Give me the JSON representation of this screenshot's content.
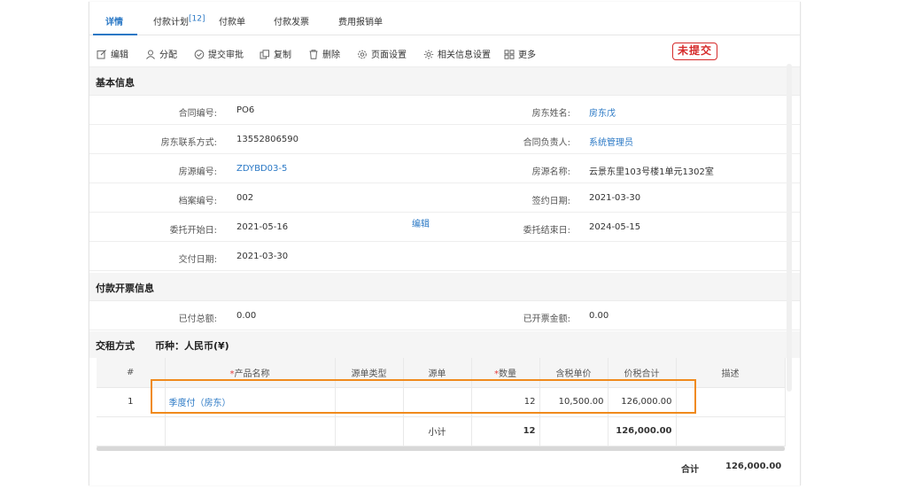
{
  "tabs": [
    {
      "label": "详情"
    },
    {
      "label": "付款计划",
      "badge": "[12]"
    },
    {
      "label": "付款单"
    },
    {
      "label": "付款发票"
    },
    {
      "label": "费用报销单"
    }
  ],
  "toolbar": {
    "edit": "编辑",
    "assign": "分配",
    "submit": "提交审批",
    "copy": "复制",
    "delete": "删除",
    "page_settings": "页面设置",
    "related_settings": "相关信息设置",
    "more": "更多"
  },
  "status_stamp": "未提交",
  "basic": {
    "title": "基本信息",
    "contract_no_label": "合同编号:",
    "contract_no": "PO6",
    "landlord_name_label": "房东姓名:",
    "landlord_name": "房东戊",
    "landlord_contact_label": "房东联系方式:",
    "landlord_contact": "13552806590",
    "contract_owner_label": "合同负责人:",
    "contract_owner": "系统管理员",
    "house_no_label": "房源编号:",
    "house_no": "ZDYBD03-5",
    "house_name_label": "房源名称:",
    "house_name": "云景东里103号楼1单元1302室",
    "archive_no_label": "档案编号:",
    "archive_no": "002",
    "sign_date_label": "签约日期:",
    "sign_date": "2021-03-30",
    "entrust_start_label": "委托开始日:",
    "entrust_start": "2021-05-16",
    "entrust_end_label": "委托结束日:",
    "entrust_end": "2024-05-15",
    "delivery_date_label": "交付日期:",
    "delivery_date": "2021-03-30",
    "edit_link": "编辑"
  },
  "invoice": {
    "title": "付款开票信息",
    "paid_total_label": "已付总额:",
    "paid_total": "0.00",
    "invoiced_label": "已开票金额:",
    "invoiced": "0.00"
  },
  "rent": {
    "title": "交租方式",
    "currency": "币种：人民币(¥)",
    "columns": {
      "index": "#",
      "product": "产品名称",
      "source_type": "源单类型",
      "source": "源单",
      "qty": "数量",
      "unit_price": "含税单价",
      "total": "价税合计",
      "desc": "描述"
    },
    "rows": [
      {
        "index": "1",
        "product": "季度付（房东）",
        "source_type": "",
        "source": "",
        "qty": "12",
        "unit_price": "10,500.00",
        "total": "126,000.00",
        "desc": ""
      }
    ],
    "subtotal_label": "小计",
    "subtotal_qty": "12",
    "subtotal_total": "126,000.00",
    "grand_total_label": "合计",
    "grand_total": "126,000.00"
  }
}
